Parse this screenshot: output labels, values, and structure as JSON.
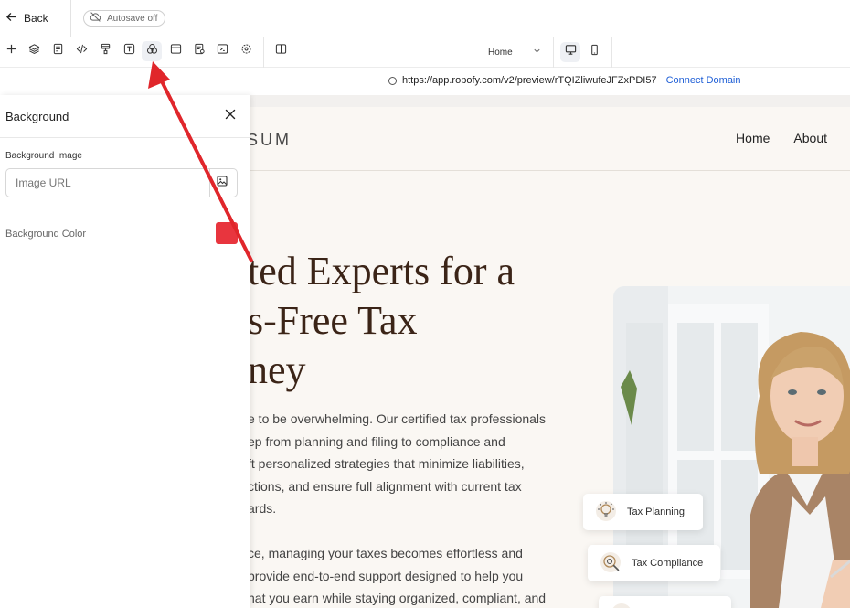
{
  "header": {
    "back_label": "Back",
    "autosave_label": "Autosave off"
  },
  "toolbar": {
    "tools": [
      "plus-icon",
      "layers-icon",
      "page-icon",
      "code-icon",
      "brush-icon",
      "text-icon",
      "color-shapes-icon",
      "section-icon",
      "form-icon",
      "embed-icon",
      "settings-icon"
    ],
    "active_tool": "color-shapes-icon",
    "panel_toggle": "split-view-icon",
    "page_select": "Home",
    "devices": [
      "desktop-icon",
      "mobile-icon"
    ],
    "active_device": "desktop-icon"
  },
  "urlbar": {
    "url": "https://app.ropofy.com/v2/preview/rTQIZliwufeJFZxPDI57",
    "connect_label": "Connect Domain"
  },
  "site": {
    "brand": "SUM",
    "nav": [
      "Home",
      "About"
    ],
    "hero_title_lines": [
      "ted Experts for a",
      "s-Free Tax",
      "ney"
    ],
    "hero_p1_lines": [
      "e to be overwhelming. Our certified tax professionals",
      "ep from planning and filing to compliance and",
      "ft personalized strategies that minimize liabilities,",
      "ctions, and ensure full alignment with current tax",
      "ards."
    ],
    "hero_p2_lines": [
      "ce, managing your taxes becomes effortless and",
      " provide end-to-end support designed to help you",
      "hat you earn while staying organized, compliant, and"
    ],
    "features": [
      "Tax Planning",
      "Tax Compliance"
    ]
  },
  "panel": {
    "title": "Background",
    "image_label": "Background Image",
    "image_placeholder": "Image URL",
    "image_value": "",
    "color_label": "Background Color",
    "color_value": "#e8353e"
  },
  "colors": {
    "accent_blue": "#1f5fd6",
    "annotation_red": "#e0262b",
    "hero_text": "#3b2417",
    "preview_bg": "#faf7f3"
  }
}
